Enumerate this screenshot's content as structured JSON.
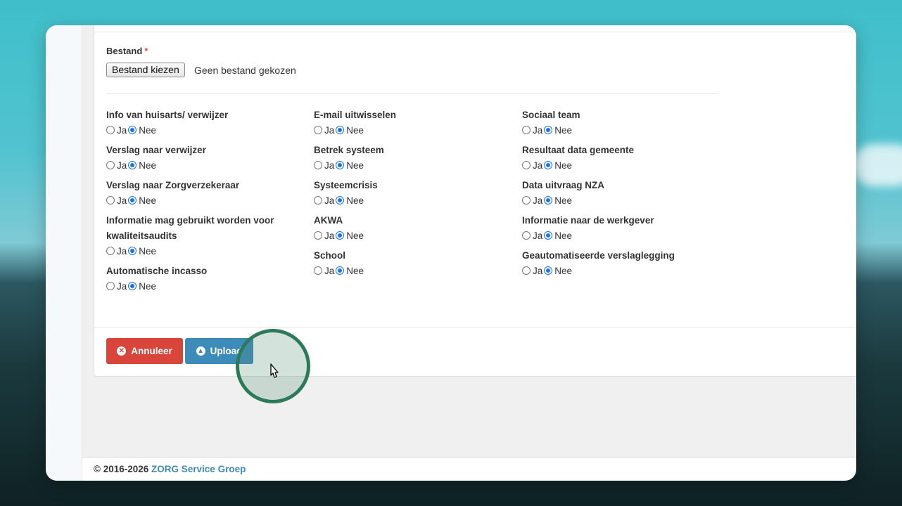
{
  "form": {
    "file_label": "Bestand",
    "required_marker": "*",
    "file_button": "Bestand kiezen",
    "file_status": "Geen bestand gekozen",
    "yes_label": "Ja",
    "no_label": "Nee",
    "columns": [
      [
        {
          "label": "Info van huisarts/ verwijzer",
          "value": "Nee"
        },
        {
          "label": "Verslag naar verwijzer",
          "value": "Nee"
        },
        {
          "label": "Verslag naar Zorgverzekeraar",
          "value": "Nee"
        },
        {
          "label": "Informatie mag gebruikt worden voor kwaliteitsaudits",
          "value": "Nee"
        },
        {
          "label": "Automatische incasso",
          "value": "Nee"
        }
      ],
      [
        {
          "label": "E-mail uitwisselen",
          "value": "Nee"
        },
        {
          "label": "Betrek systeem",
          "value": "Nee"
        },
        {
          "label": "Systeemcrisis",
          "value": "Nee"
        },
        {
          "label": "AKWA",
          "value": "Nee"
        },
        {
          "label": "School",
          "value": "Nee"
        }
      ],
      [
        {
          "label": "Sociaal team",
          "value": "Nee"
        },
        {
          "label": "Resultaat data gemeente",
          "value": "Nee"
        },
        {
          "label": "Data uitvraag NZA",
          "value": "Nee"
        },
        {
          "label": "Informatie naar de werkgever",
          "value": "Nee"
        },
        {
          "label": "Geautomatiseerde verslaglegging",
          "value": "Nee"
        }
      ]
    ]
  },
  "actions": {
    "cancel_label": "Annuleer",
    "upload_label": "Upload",
    "cancel_icon": "times-circle-icon",
    "upload_icon": "arrow-up-circle-icon",
    "cancel_color": "#d9453b",
    "upload_color": "#3d8bb8"
  },
  "footer": {
    "copyright": "© 2016-2026",
    "brand": "ZORG Service Groep"
  }
}
